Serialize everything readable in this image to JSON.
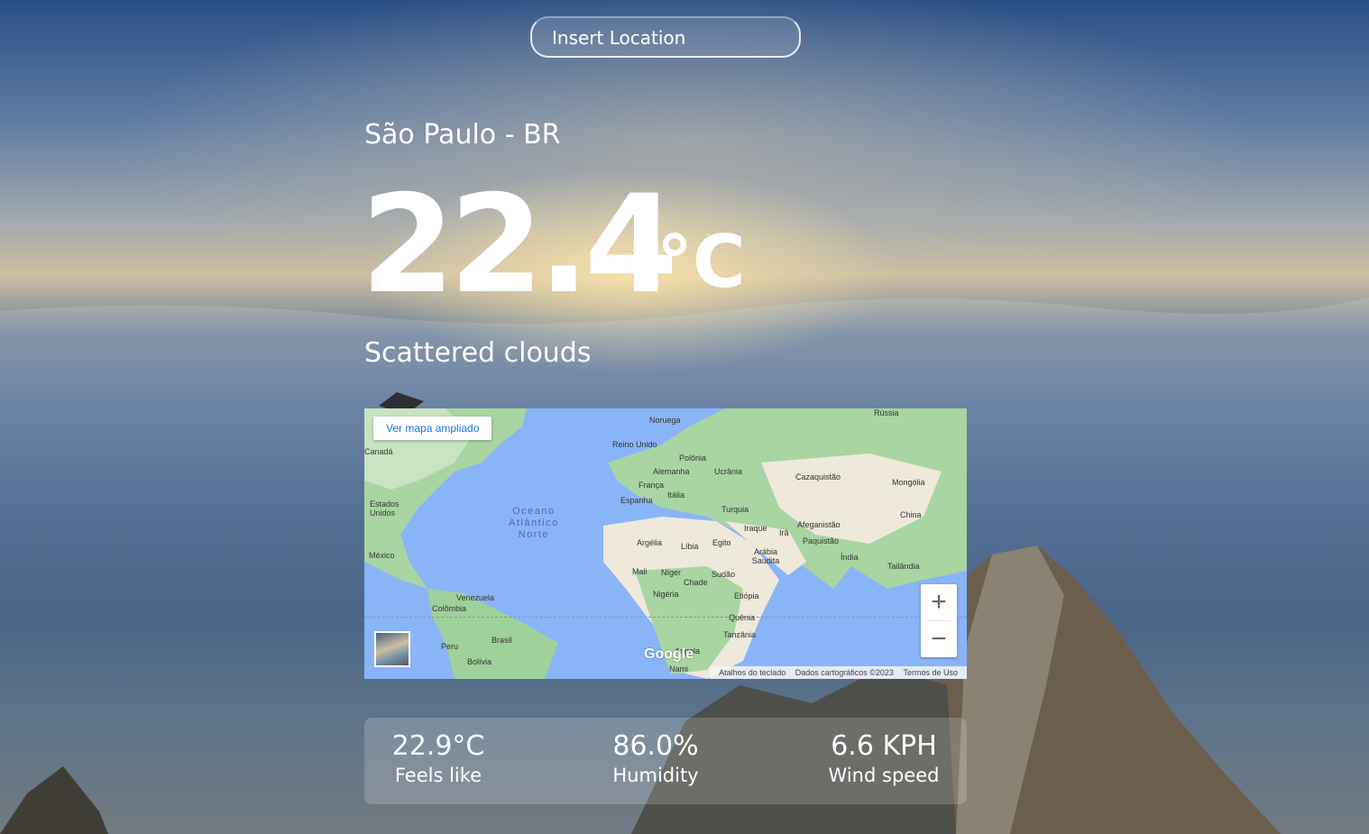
{
  "search": {
    "placeholder": "Insert Location"
  },
  "location": {
    "city": "São Paulo",
    "country": "BR",
    "separator": " - "
  },
  "weather": {
    "temperature": "22.4",
    "unit": "°C",
    "condition": "Scattered clouds"
  },
  "map": {
    "open_larger_label": "Ver mapa ampliado",
    "ocean_label": "Oceano\nAtlântico\nNorte",
    "labels": [
      "Canadá",
      "Estados Unidos",
      "México",
      "Venezuela",
      "Colômbia",
      "Peru",
      "Brasil",
      "Bolívia",
      "Noruega",
      "Reino Unido",
      "Polônia",
      "Alemanha",
      "Ucrânia",
      "França",
      "Itália",
      "Espanha",
      "Turquia",
      "Rússia",
      "Cazaquistão",
      "Mongólia",
      "China",
      "Afeganistão",
      "Irã",
      "Iraque",
      "Paquistão",
      "Índia",
      "Tailândia",
      "Argélia",
      "Líbia",
      "Egito",
      "Arábia Saudita",
      "Mali",
      "Níger",
      "Chade",
      "Sudão",
      "Nigéria",
      "Etiópia",
      "Quênia",
      "Tanzânia",
      "Angola",
      "Nami"
    ],
    "brand": "Google",
    "attribution": [
      "Atalhos do teclado",
      "Dados cartográficos ©2023",
      "Termos de Uso"
    ],
    "zoom_in": "+",
    "zoom_out": "−"
  },
  "stats": {
    "feels_like": {
      "value": "22.9°C",
      "label": "Feels like"
    },
    "humidity": {
      "value": "86.0%",
      "label": "Humidity"
    },
    "wind": {
      "value": "6.6 KPH",
      "label": "Wind speed"
    }
  }
}
